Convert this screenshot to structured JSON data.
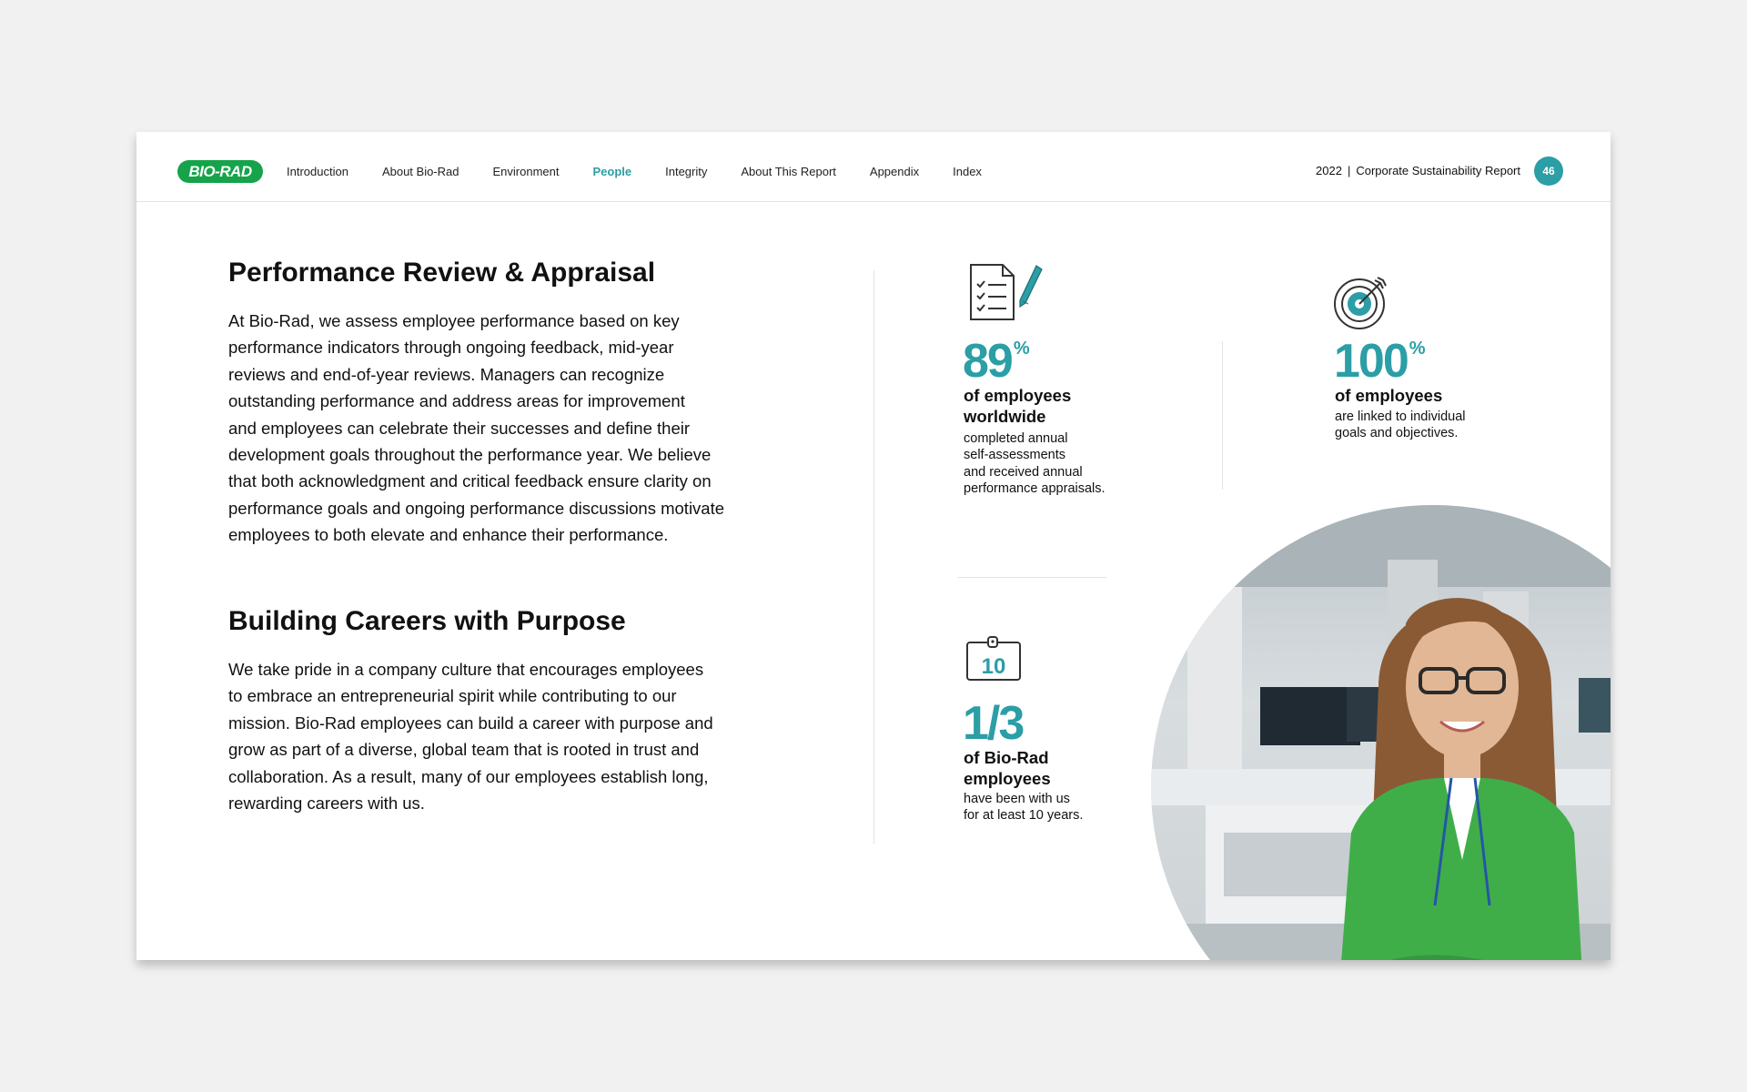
{
  "header": {
    "logo_text": "BIO-RAD",
    "nav": [
      "Introduction",
      "About Bio-Rad",
      "Environment",
      "People",
      "Integrity",
      "About This Report",
      "Appendix",
      "Index"
    ],
    "active_nav": "People",
    "report_year": "2022",
    "report_separator": "|",
    "report_name": "Corporate Sustainability Report",
    "page_number": "46"
  },
  "sections": {
    "performance": {
      "title": "Performance Review & Appraisal",
      "body": "At Bio-Rad, we assess employee performance based on key\nperformance indicators through ongoing feedback, mid-year\nreviews and end-of-year reviews. Managers can recognize\noutstanding performance and address areas for improvement\nand employees can celebrate their successes and define their\ndevelopment goals throughout the performance year. We believe\nthat both acknowledgment and critical feedback ensure clarity on\nperformance goals and ongoing performance discussions motivate\nemployees to both elevate and enhance their performance."
    },
    "careers": {
      "title": "Building Careers with Purpose",
      "body": "We take pride in a company culture that encourages employees\nto embrace an entrepreneurial spirit while contributing to our\nmission. Bio-Rad employees can build a career with purpose and\ngrow as part of a diverse, global team that is rooted in trust and\ncollaboration. As a result, many of our employees establish long,\nrewarding careers with us."
    }
  },
  "stats": {
    "self_assess": {
      "icon": "checklist-pencil-icon",
      "number": "89",
      "unit": "%",
      "headline": "of employees\nworldwide",
      "description": "completed annual\nself-assessments\nand received annual\nperformance appraisals."
    },
    "goals": {
      "icon": "target-icon",
      "number": "100",
      "unit": "%",
      "headline": "of employees",
      "description": "are linked to individual\ngoals and objectives."
    },
    "tenure": {
      "icon": "badge-10-icon",
      "icon_text": "10",
      "number": "1/3",
      "headline": "of Bio-Rad\nemployees",
      "description": "have been with us\nfor at least 10 years."
    }
  },
  "colors": {
    "accent": "#2b9ea6",
    "brand_green": "#16a34a",
    "cardigan_green": "#3fae49"
  }
}
